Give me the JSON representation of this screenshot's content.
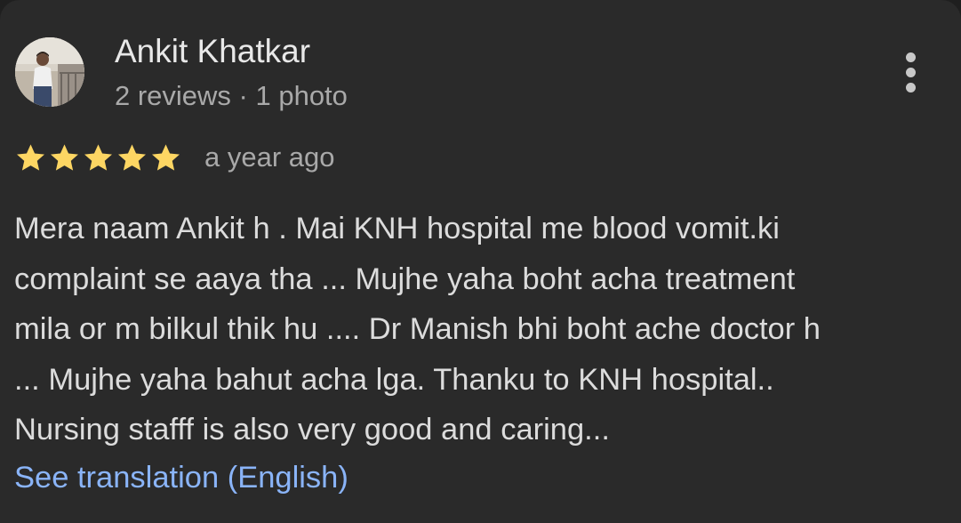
{
  "review": {
    "author": {
      "name": "Ankit Khatkar",
      "meta": "2 reviews · 1 photo",
      "avatar_icon": "profile-photo"
    },
    "more_icon": "more-vertical-icon",
    "rating": 5,
    "rating_max": 5,
    "star_color": "#fdd663",
    "date": "a year ago",
    "text_lines": [
      "Mera naam Ankit h . Mai KNH hospital me blood vomit.ki",
      "complaint se aaya tha ... Mujhe yaha boht acha treatment",
      "mila or m bilkul thik hu .... Dr Manish bhi boht ache doctor h",
      "... Mujhe yaha bahut acha lga. Thanku to KNH hospital..",
      "Nursing stafff is also very good and caring..."
    ],
    "translate_label": "See translation (English)",
    "link_color": "#8ab4f8"
  }
}
